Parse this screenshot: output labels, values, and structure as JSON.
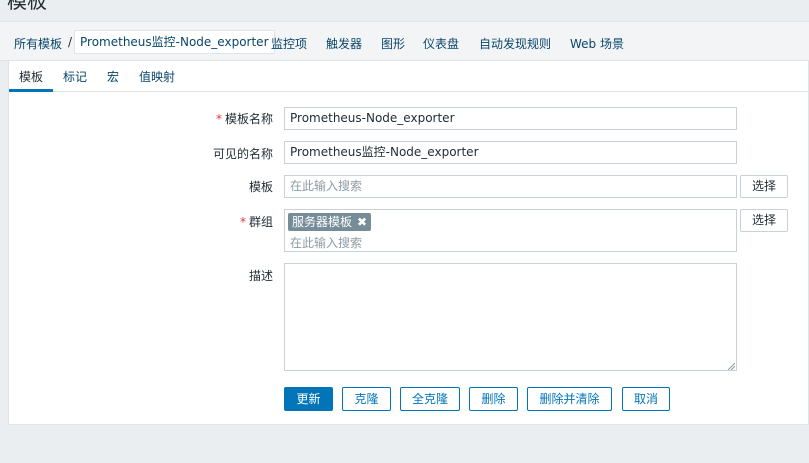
{
  "page": {
    "title": "模板"
  },
  "breadcrumb": {
    "all_templates": "所有模板",
    "separator": "/",
    "current": "Prometheus监控-Node_exporter",
    "items": [
      "监控项",
      "触发器",
      "图形",
      "仪表盘",
      "自动发现规则",
      "Web 场景"
    ]
  },
  "tabs": [
    "模板",
    "标记",
    "宏",
    "值映射"
  ],
  "form": {
    "template_name": {
      "label": "模板名称",
      "required_mark": "*",
      "value": "Prometheus-Node_exporter"
    },
    "visible_name": {
      "label": "可见的名称",
      "value": "Prometheus监控-Node_exporter"
    },
    "templates": {
      "label": "模板",
      "placeholder": "在此输入搜索",
      "select_label": "选择"
    },
    "groups": {
      "label": "群组",
      "required_mark": "*",
      "chip": "服务器模板",
      "chip_remove": "✖",
      "placeholder": "在此输入搜索",
      "select_label": "选择"
    },
    "description": {
      "label": "描述",
      "value": ""
    }
  },
  "buttons": {
    "update": "更新",
    "clone": "克隆",
    "full_clone": "全克隆",
    "delete": "删除",
    "delete_and_clear": "删除并清除",
    "cancel": "取消"
  },
  "colors": {
    "accent": "#0275b8",
    "link": "#0a466a",
    "required": "#e33734",
    "chip_bg": "#768d99"
  }
}
